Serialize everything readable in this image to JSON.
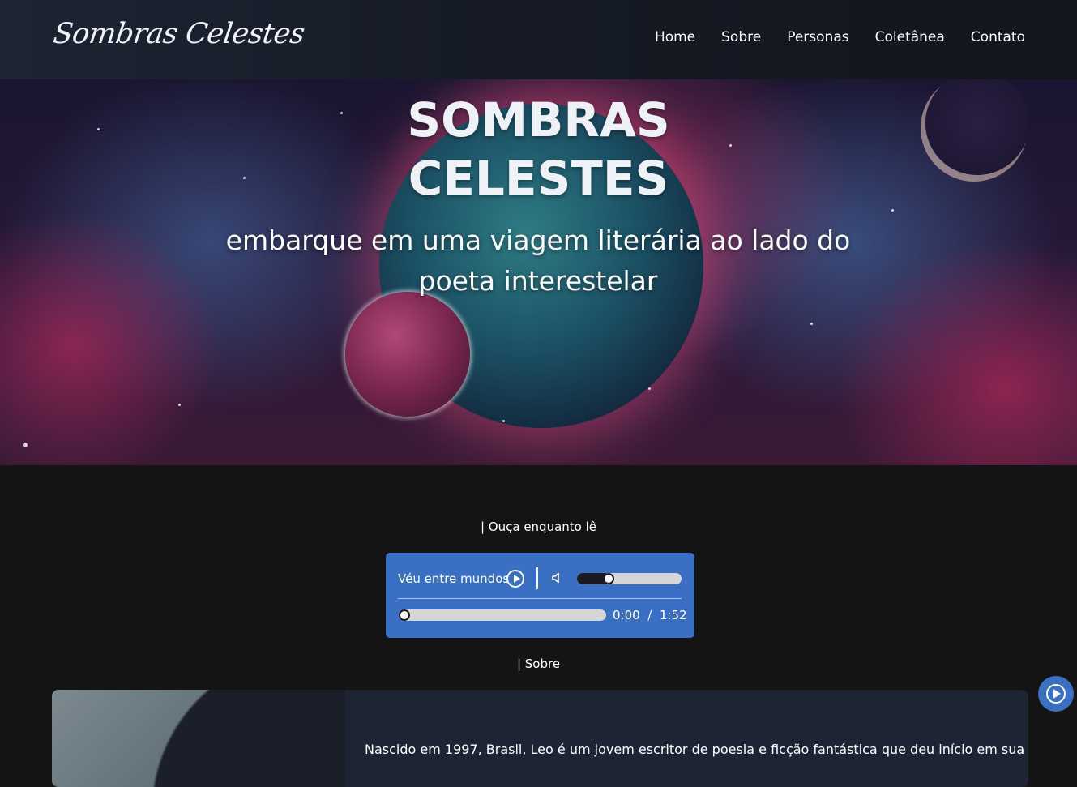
{
  "nav": {
    "logo_text": "Sombras Celestes",
    "links": [
      "Home",
      "Sobre",
      "Personas",
      "Coletânea",
      "Contato"
    ]
  },
  "hero": {
    "title_line1": "SOMBRAS",
    "title_line2": "CELESTES",
    "subtitle": "embarque em uma viagem literária ao lado do poeta interestelar"
  },
  "listen": {
    "label": "| Ouça enquanto lê"
  },
  "player": {
    "track_name": "Véu entre mundos",
    "current_time": "0:00",
    "separator": "/",
    "duration": "1:52",
    "volume_level": 0.28,
    "progress": 0,
    "play_icon": "play-circle-icon",
    "volume_icon": "speaker-icon"
  },
  "about": {
    "label": "| Sobre",
    "text": "Nascido em 1997, Brasil, Leo é um jovem escritor de poesia e ficção fantástica que deu início em sua"
  },
  "colors": {
    "accent": "#3a6fc4",
    "navbar": "#1d2433",
    "background": "#141414"
  }
}
